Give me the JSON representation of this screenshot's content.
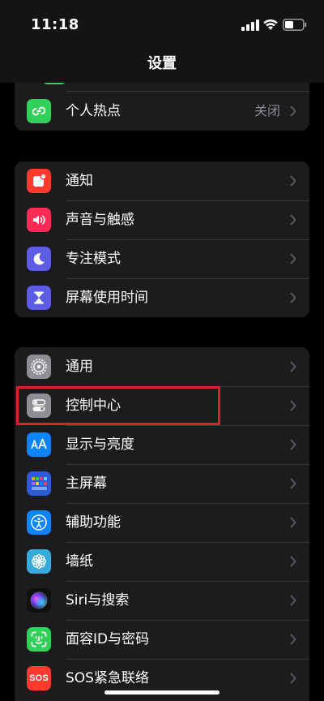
{
  "status_bar": {
    "time": "11:18"
  },
  "nav": {
    "title": "设置"
  },
  "groups": [
    {
      "items": [
        {
          "label": "个人热点",
          "value": "关闭",
          "icon": "personal-hotspot-icon",
          "color": "#30d158"
        }
      ]
    },
    {
      "items": [
        {
          "label": "通知",
          "icon": "notification-bell-icon",
          "color": "#ff3b30"
        },
        {
          "label": "声音与触感",
          "icon": "speaker-icon",
          "color": "#ff2d55"
        },
        {
          "label": "专注模式",
          "icon": "moon-icon",
          "color": "#5e5ce6"
        },
        {
          "label": "屏幕使用时间",
          "icon": "hourglass-icon",
          "color": "#5e5ce6"
        }
      ]
    },
    {
      "items": [
        {
          "label": "通用",
          "icon": "gear-icon",
          "color": "#8e8e93"
        },
        {
          "label": "控制中心",
          "icon": "toggle-switches-icon",
          "color": "#8e8e93"
        },
        {
          "label": "显示与亮度",
          "icon": "text-size-icon",
          "color": "#0a84ff"
        },
        {
          "label": "主屏幕",
          "icon": "home-screen-grid-icon",
          "color": "#2c5ad8"
        },
        {
          "label": "辅助功能",
          "icon": "accessibility-icon",
          "color": "#0a84ff"
        },
        {
          "label": "墙纸",
          "icon": "flower-icon",
          "color": "#35aadc"
        },
        {
          "label": "Siri与搜索",
          "icon": "siri-orb-icon",
          "color": "#111111"
        },
        {
          "label": "面容ID与密码",
          "icon": "face-id-icon",
          "color": "#30d158"
        },
        {
          "label": "SOS紧急联络",
          "icon": "sos-icon",
          "color": "#ff3b30",
          "icon_text": "SOS"
        }
      ]
    }
  ]
}
